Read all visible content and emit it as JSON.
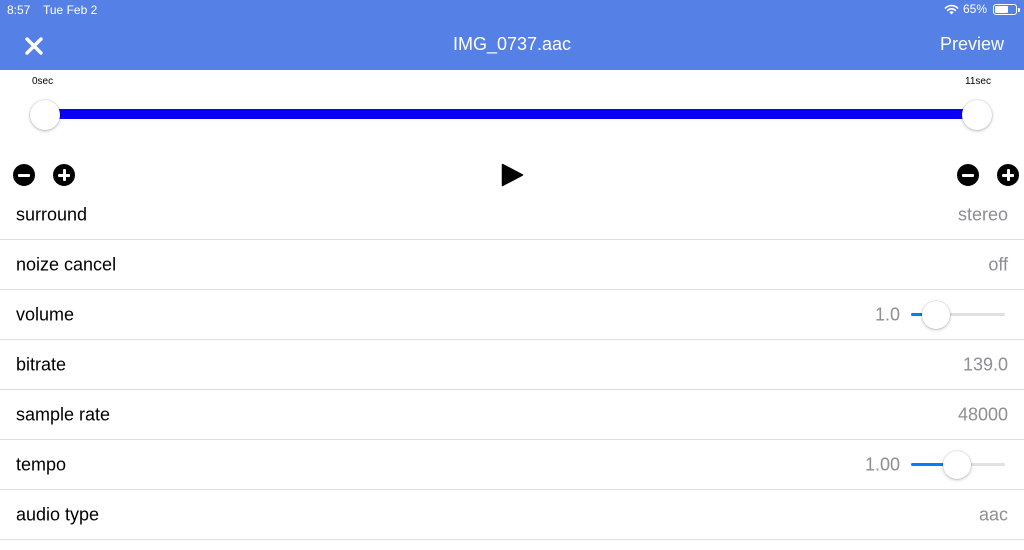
{
  "status_bar": {
    "time": "8:57",
    "date": "Tue Feb 2",
    "battery_text": "65%",
    "battery_level": 0.65
  },
  "header": {
    "title": "IMG_0737.aac",
    "preview_label": "Preview"
  },
  "trim": {
    "start_label": "0sec",
    "end_label": "11sec"
  },
  "settings": {
    "surround": {
      "label": "surround",
      "value": "stereo"
    },
    "noise_cancel": {
      "label": "noize cancel",
      "value": "off"
    },
    "volume": {
      "label": "volume",
      "value": "1.0",
      "slider_fraction": 0.27
    },
    "bitrate": {
      "label": "bitrate",
      "value": "139.0"
    },
    "sample_rate": {
      "label": "sample rate",
      "value": "48000"
    },
    "tempo": {
      "label": "tempo",
      "value": "1.00",
      "slider_fraction": 0.49
    },
    "audio_type": {
      "label": "audio type",
      "value": "aac"
    }
  },
  "icons": [
    "close-icon",
    "wifi-icon",
    "battery-icon",
    "minus-icon",
    "plus-icon",
    "play-icon"
  ],
  "colors": {
    "header_bg": "#5581e6",
    "range_fill": "#0a00f5",
    "slider_fill": "#0a7aff",
    "value_text": "#8e8e93"
  }
}
